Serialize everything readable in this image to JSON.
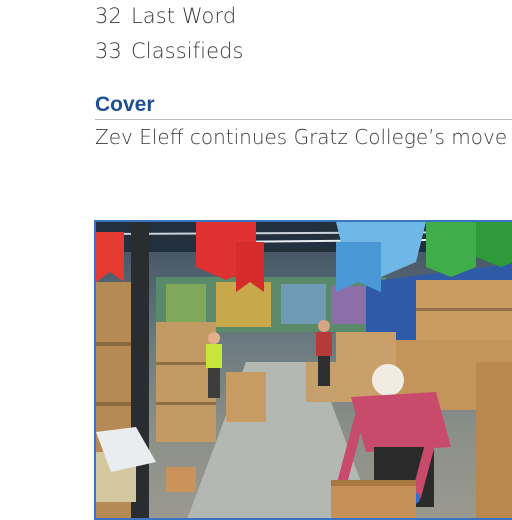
{
  "toc": [
    {
      "page": "32",
      "title": "Last Word"
    },
    {
      "page": "33",
      "title": "Classifieds"
    }
  ],
  "section": {
    "heading": "Cover",
    "teaser": "Zev Eleff continues Gratz College’s move"
  },
  "photo": {
    "description_icon": "warehouse-photo",
    "colors": {
      "border": "#3a73c2",
      "heading": "#1f4f95"
    }
  }
}
